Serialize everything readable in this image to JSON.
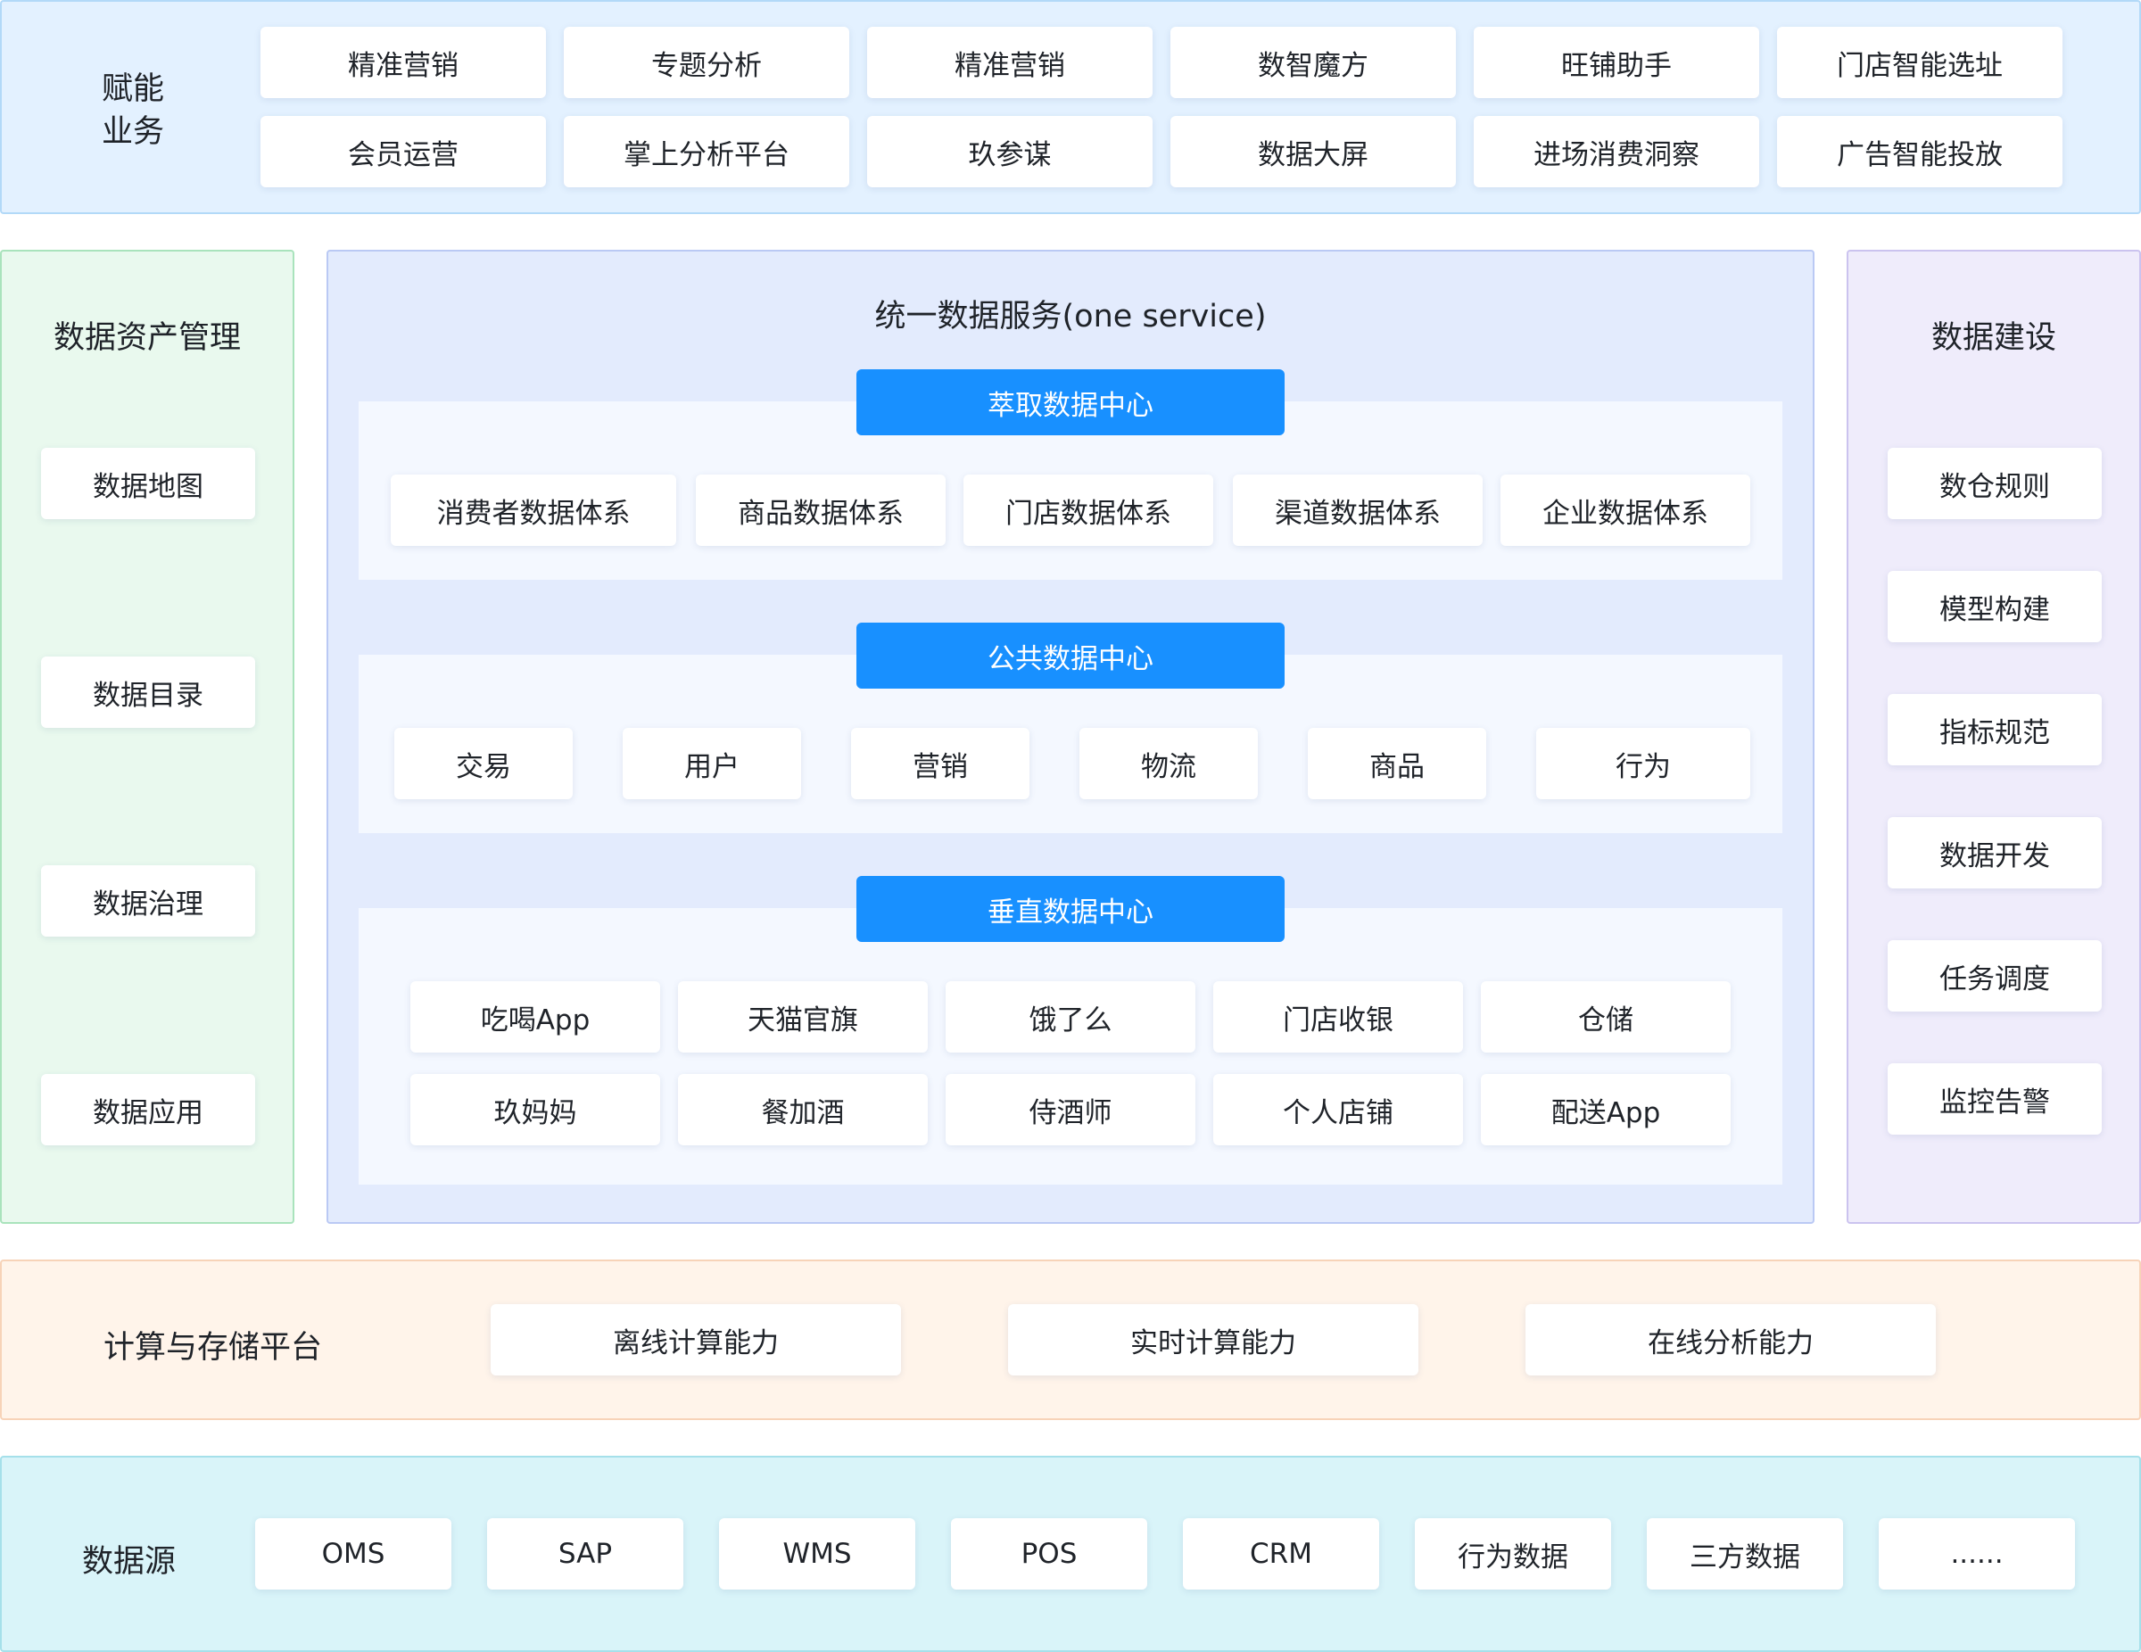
{
  "top": {
    "title_line1": "赋能",
    "title_line2": "业务",
    "row1": [
      "精准营销",
      "专题分析",
      "精准营销",
      "数智魔方",
      "旺铺助手",
      "门店智能选址"
    ],
    "row2": [
      "会员运营",
      "掌上分析平台",
      "玖参谋",
      "数据大屏",
      "进场消费洞察",
      "广告智能投放"
    ]
  },
  "left": {
    "title": "数据资产管理",
    "items": [
      "数据地图",
      "数据目录",
      "数据治理",
      "数据应用"
    ]
  },
  "center": {
    "title": "统一数据服务(one service)",
    "extract": {
      "head": "萃取数据中心",
      "items": [
        "消费者数据体系",
        "商品数据体系",
        "门店数据体系",
        "渠道数据体系",
        "企业数据体系"
      ]
    },
    "public": {
      "head": "公共数据中心",
      "items": [
        "交易",
        "用户",
        "营销",
        "物流",
        "商品",
        "行为"
      ]
    },
    "vertical": {
      "head": "垂直数据中心",
      "row1": [
        "吃喝App",
        "天猫官旗",
        "饿了么",
        "门店收银",
        "仓储"
      ],
      "row2": [
        "玖妈妈",
        "餐加酒",
        "侍酒师",
        "个人店铺",
        "配送App"
      ]
    }
  },
  "right": {
    "title": "数据建设",
    "items": [
      "数仓规则",
      "模型构建",
      "指标规范",
      "数据开发",
      "任务调度",
      "监控告警"
    ]
  },
  "compute": {
    "title": "计算与存储平台",
    "items": [
      "离线计算能力",
      "实时计算能力",
      "在线分析能力"
    ]
  },
  "source": {
    "title": "数据源",
    "items": [
      "OMS",
      "SAP",
      "WMS",
      "POS",
      "CRM",
      "行为数据",
      "三方数据",
      "......"
    ]
  },
  "colors": {
    "accent_blue": "#1890ff",
    "top_bg": "#e3f1ff",
    "left_bg": "#e9f9ee",
    "center_bg": "#e3ebfd",
    "right_bg": "#efecfb",
    "compute_bg": "#fff4ea",
    "source_bg": "#d9f4f9"
  }
}
